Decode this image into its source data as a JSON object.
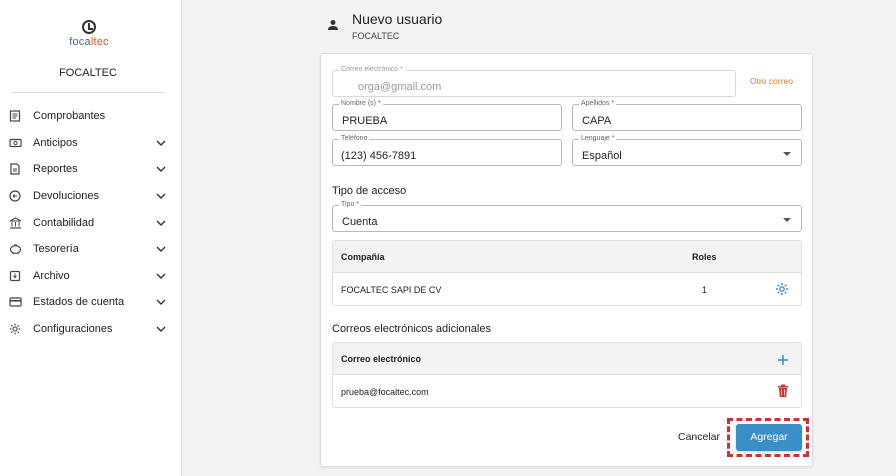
{
  "sidebar": {
    "logo": {
      "part1": "foca",
      "part2": "ltec"
    },
    "org_name": "FOCALTEC",
    "items": [
      {
        "label": "Comprobantes",
        "icon": "receipt-icon",
        "expandable": false
      },
      {
        "label": "Anticipos",
        "icon": "payment-icon",
        "expandable": true
      },
      {
        "label": "Reportes",
        "icon": "report-icon",
        "expandable": true
      },
      {
        "label": "Devoluciones",
        "icon": "return-icon",
        "expandable": true
      },
      {
        "label": "Contabilidad",
        "icon": "bank-icon",
        "expandable": true
      },
      {
        "label": "Tesorería",
        "icon": "piggy-bank-icon",
        "expandable": true
      },
      {
        "label": "Archivo",
        "icon": "archive-icon",
        "expandable": true
      },
      {
        "label": "Estados de cuenta",
        "icon": "credit-card-icon",
        "expandable": true
      },
      {
        "label": "Configuraciones",
        "icon": "gear-icon",
        "expandable": true
      }
    ]
  },
  "header": {
    "title": "Nuevo usuario",
    "subtitle": "FOCALTEC"
  },
  "form": {
    "email": {
      "label": "Correo electrónico *",
      "value": "orga@gmail.com",
      "disabled": true
    },
    "other_email_link": "Otro correo",
    "first_name": {
      "label": "Nombre (s) *",
      "value": "PRUEBA"
    },
    "last_name": {
      "label": "Apellidos *",
      "value": "CAPA"
    },
    "phone": {
      "label": "Teléfono",
      "value": "(123) 456-7891"
    },
    "language": {
      "label": "Lenguaje *",
      "value": "Español"
    }
  },
  "access": {
    "title": "Tipo de acceso",
    "type": {
      "label": "Tipo *",
      "value": "Cuenta"
    }
  },
  "company_table": {
    "headers": {
      "company": "Compañía",
      "roles": "Roles"
    },
    "rows": [
      {
        "company": "FOCALTEC SAPI DE CV",
        "roles": "1"
      }
    ]
  },
  "emails_section": {
    "title": "Correos electrónicos adicionales",
    "header": "Correo electrónico",
    "rows": [
      {
        "email": "prueba@focaltec.com"
      }
    ]
  },
  "actions": {
    "cancel": "Cancelar",
    "add": "Agregar"
  },
  "colors": {
    "accent": "#3b8fc7",
    "link_orange": "#e07a1a",
    "delete_red": "#d32f2f",
    "highlight": "#d62e2e"
  }
}
